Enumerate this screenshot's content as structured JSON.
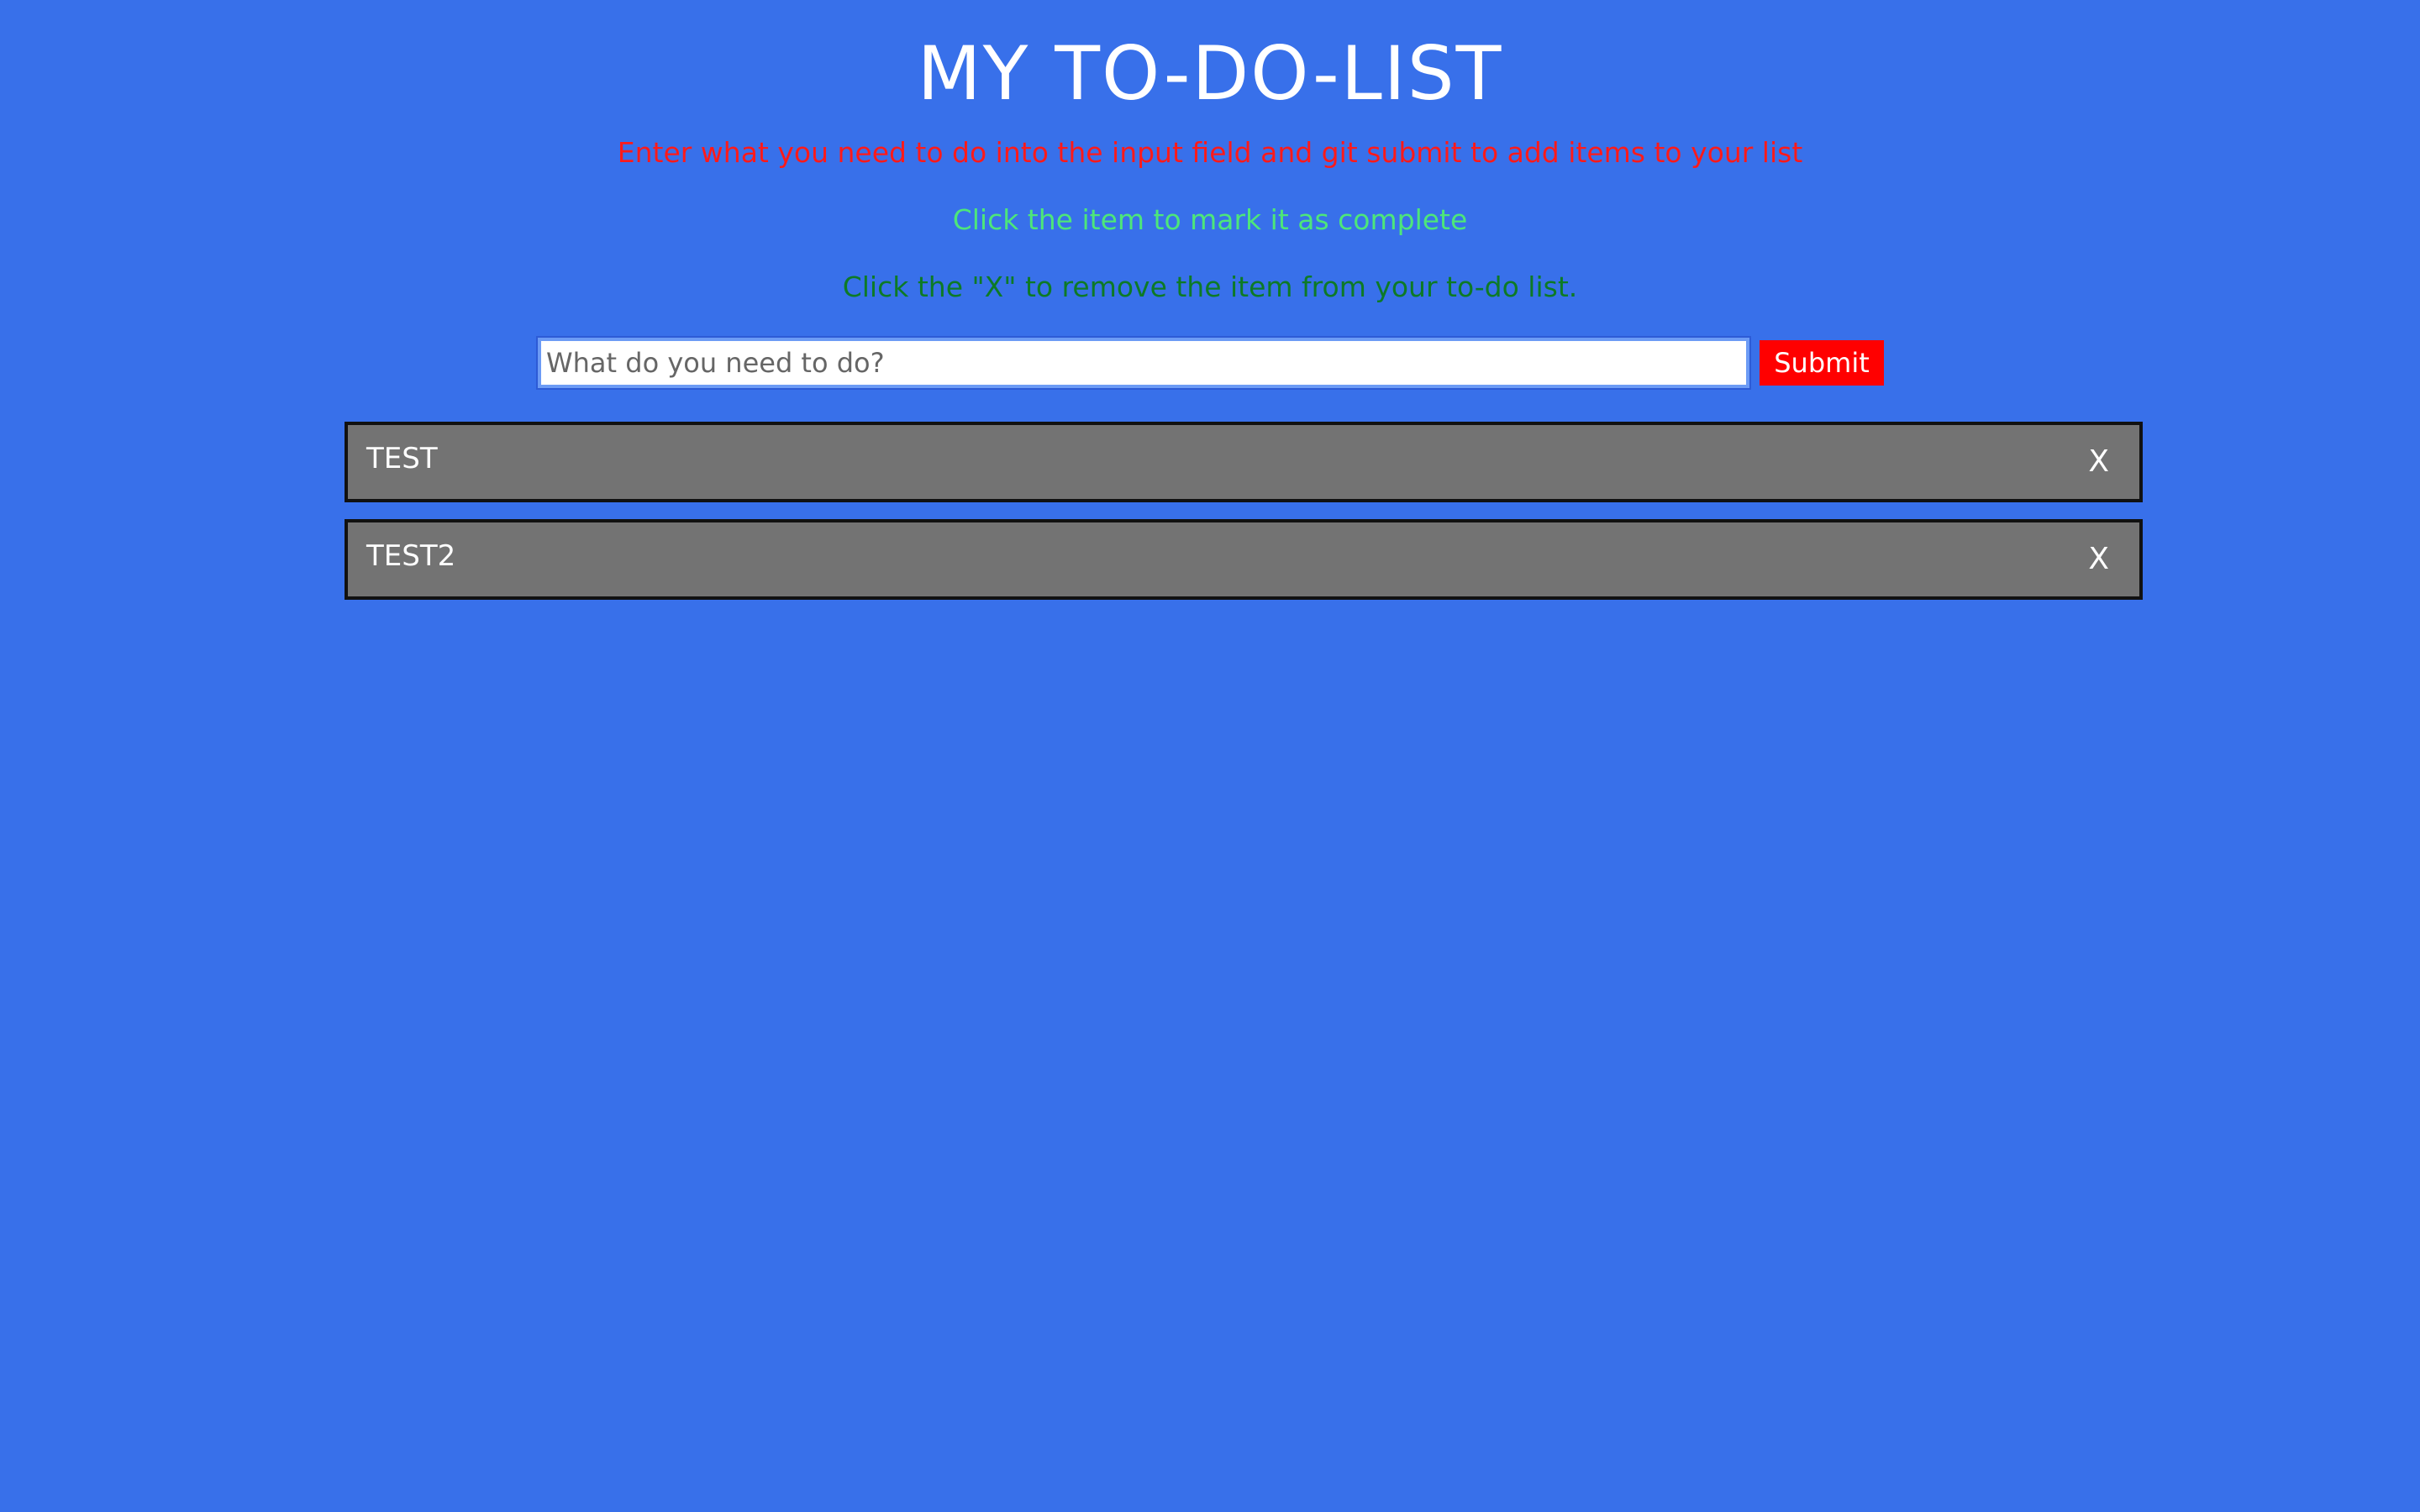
{
  "header": {
    "title": "MY TO-DO-LIST"
  },
  "instructions": {
    "line1": "Enter what you need to do into the input field and git submit to add items to your list",
    "line2": "Click the item to mark it as complete",
    "line3": "Click the \"X\" to remove the item from your to-do list."
  },
  "form": {
    "input_placeholder": "What do you need to do?",
    "input_value": "",
    "submit_label": "Submit"
  },
  "todos": [
    {
      "text": "TEST",
      "remove_label": "X"
    },
    {
      "text": "TEST2",
      "remove_label": "X"
    }
  ],
  "colors": {
    "background": "#3870EA",
    "title": "#FFFFFF",
    "instruction_red": "#FF1A1A",
    "instruction_lightgreen": "#4DE67A",
    "instruction_darkgreen": "#0D7A26",
    "submit_button": "#FF0000",
    "todo_item": "#737373"
  }
}
